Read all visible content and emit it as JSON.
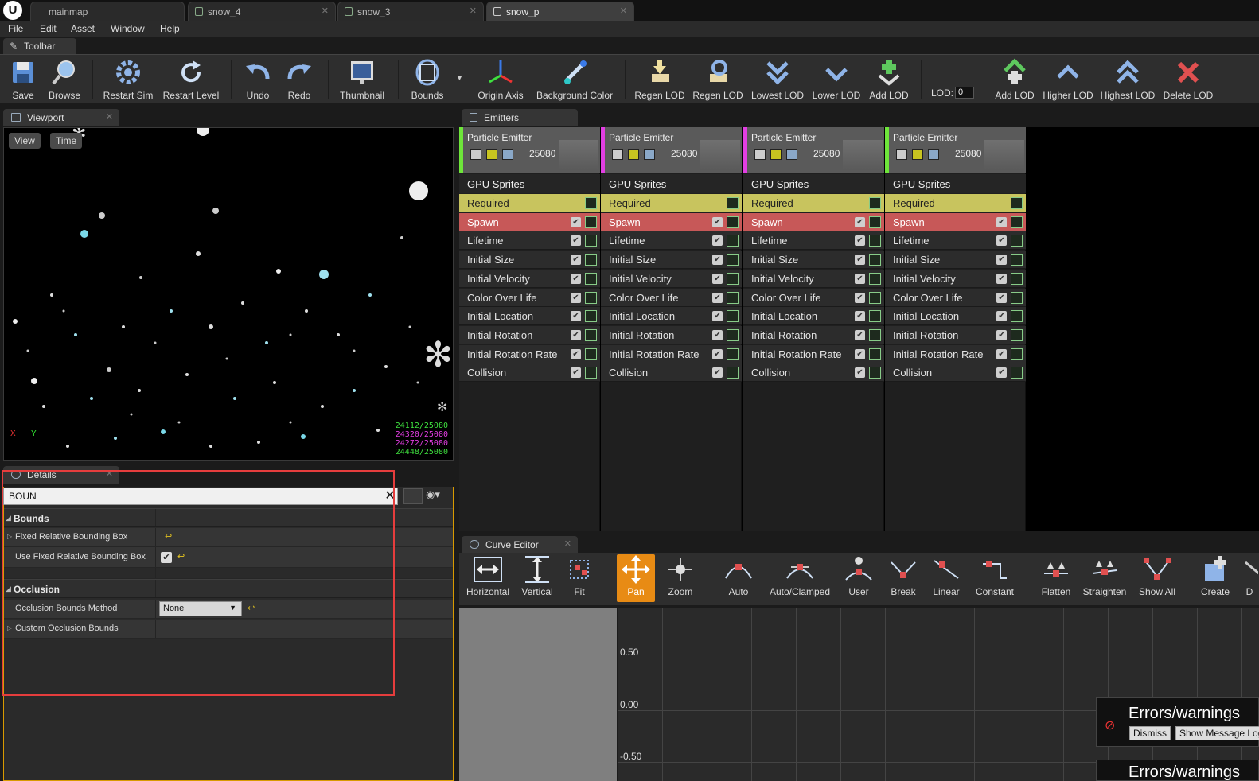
{
  "tabs": [
    {
      "label": "mainmap"
    },
    {
      "label": "snow_4"
    },
    {
      "label": "snow_3"
    },
    {
      "label": "snow_p"
    }
  ],
  "menu": [
    "File",
    "Edit",
    "Asset",
    "Window",
    "Help"
  ],
  "toolbar": {
    "title": "Toolbar",
    "buttons": [
      "Save",
      "Browse",
      "Restart Sim",
      "Restart Level",
      "Undo",
      "Redo",
      "Thumbnail",
      "Bounds",
      "Origin Axis",
      "Background Color",
      "Regen LOD",
      "Regen LOD",
      "Lowest LOD",
      "Lower LOD",
      "Add LOD",
      "Add LOD",
      "Higher LOD",
      "Highest LOD",
      "Delete LOD"
    ],
    "lod_label": "LOD:",
    "lod_value": "0"
  },
  "viewport": {
    "title": "Viewport",
    "view_btn": "View",
    "time_btn": "Time",
    "stats": [
      "24112/25080",
      "24320/25080",
      "24272/25080",
      "24448/25080"
    ],
    "stat_colors": [
      "#3ee03e",
      "#e23ee2",
      "#e23ee2",
      "#3ee03e"
    ],
    "axis_x": "X",
    "axis_y": "Y"
  },
  "details": {
    "title": "Details",
    "search_value": "BOUN",
    "categories": {
      "bounds": "Bounds",
      "occlusion": "Occlusion"
    },
    "props": {
      "fixed_bbox": "Fixed Relative Bounding Box",
      "use_fixed_bbox": "Use Fixed Relative Bounding Box",
      "occl_method": "Occlusion Bounds Method",
      "occl_method_value": "None",
      "custom_occl": "Custom Occlusion Bounds"
    }
  },
  "emitters": {
    "title": "Emitters",
    "columns": [
      {
        "name": "Particle Emitter",
        "count": "25080",
        "type": "GPU Sprites",
        "color": "#6ee63a"
      },
      {
        "name": "Particle Emitter",
        "count": "25080",
        "type": "GPU Sprites",
        "color": "#e23ee2"
      },
      {
        "name": "Particle Emitter",
        "count": "25080",
        "type": "GPU Sprites",
        "color": "#e23ee2"
      },
      {
        "name": "Particle Emitter",
        "count": "25080",
        "type": "GPU Sprites",
        "color": "#6ee63a"
      }
    ],
    "modules": [
      "Required",
      "Spawn",
      "Lifetime",
      "Initial Size",
      "Initial Velocity",
      "Color Over Life",
      "Initial Location",
      "Initial Rotation",
      "Initial Rotation Rate",
      "Collision"
    ]
  },
  "curve_editor": {
    "title": "Curve Editor",
    "buttons": [
      "Horizontal",
      "Vertical",
      "Fit",
      "Pan",
      "Zoom",
      "Auto",
      "Auto/Clamped",
      "User",
      "Break",
      "Linear",
      "Constant",
      "Flatten",
      "Straighten",
      "Show All",
      "Create",
      "D"
    ],
    "grid_labels": [
      "0.50",
      "0.00",
      "-0.50"
    ]
  },
  "notifications": {
    "title": "Errors/warnings",
    "dismiss": "Dismiss",
    "show_log": "Show Message Log"
  },
  "colors": {
    "accent_orange": "#e88b14",
    "required_row": "#c8c45e",
    "spawn_row": "#c75858",
    "highlight_box": "#e53d3d"
  }
}
